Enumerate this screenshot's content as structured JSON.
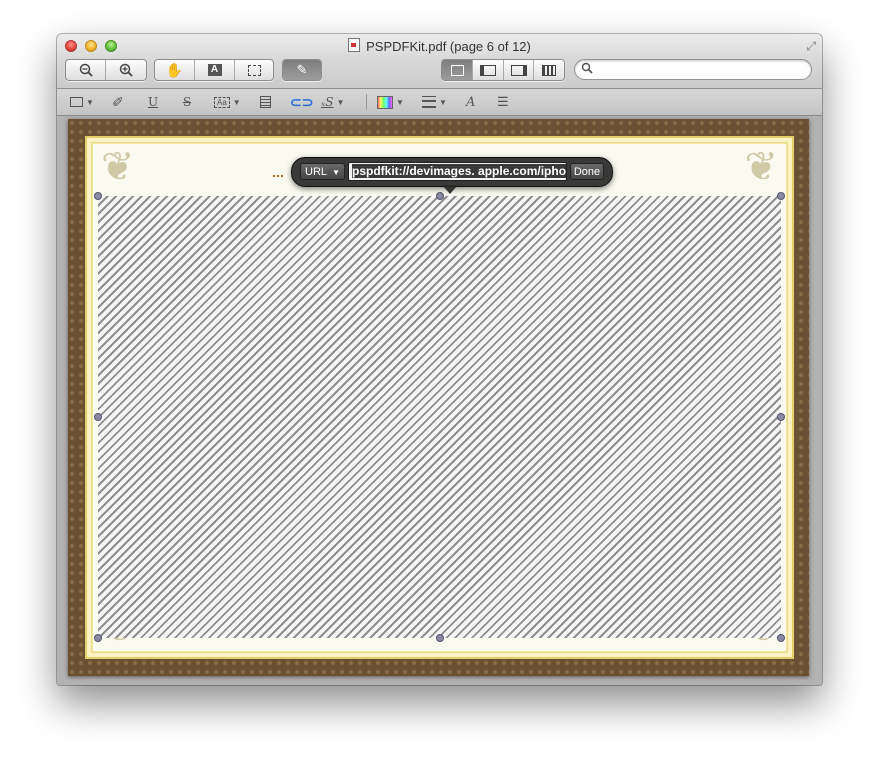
{
  "window": {
    "title": "PSPDFKit.pdf (page 6 of 12)"
  },
  "toolbar": {
    "zoom_out_icon": "zoom-out-icon",
    "zoom_in_icon": "zoom-in-icon",
    "view_modes": [
      "single-page-icon",
      "sidebar-left-icon",
      "sidebar-right-icon",
      "thumbnails-icon"
    ]
  },
  "search": {
    "placeholder": "",
    "value": ""
  },
  "link_popover": {
    "type_label": "URL",
    "url_value": "pspdfkit://devimages. apple.com/iphon",
    "done_label": "Done"
  }
}
